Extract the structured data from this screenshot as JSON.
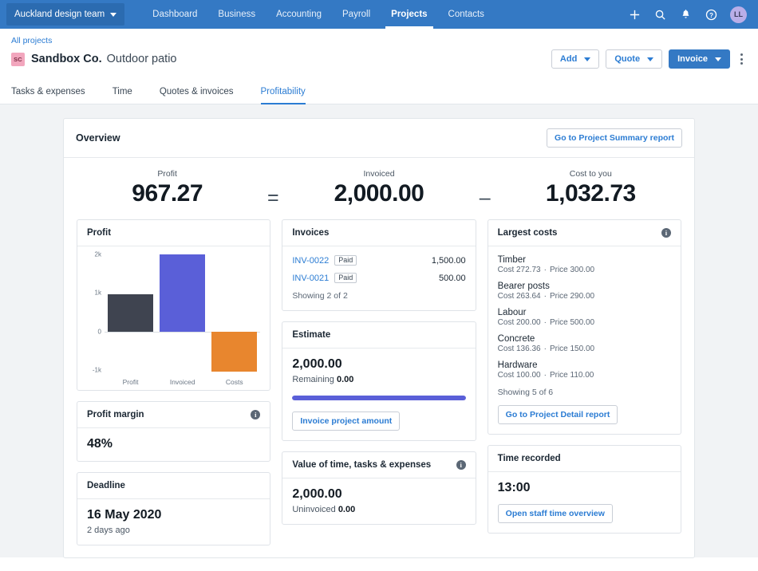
{
  "topnav": {
    "org": "Auckland design team",
    "items": [
      {
        "label": "Dashboard",
        "active": false
      },
      {
        "label": "Business",
        "active": false
      },
      {
        "label": "Accounting",
        "active": false
      },
      {
        "label": "Payroll",
        "active": false
      },
      {
        "label": "Projects",
        "active": true
      },
      {
        "label": "Contacts",
        "active": false
      }
    ],
    "icons": [
      "plus-icon",
      "search-icon",
      "bell-icon",
      "help-icon"
    ],
    "avatar_initials": "LL",
    "colors": {
      "bar": "#3479c4",
      "org_chip": "#2b6bb0",
      "avatar": "#b9aee8"
    }
  },
  "header": {
    "breadcrumb": "All projects",
    "client_initials": "SC",
    "client_name": "Sandbox Co.",
    "project_name": "Outdoor patio",
    "actions": {
      "add": "Add",
      "quote": "Quote",
      "invoice": "Invoice"
    }
  },
  "subtabs": [
    {
      "label": "Tasks & expenses",
      "active": false
    },
    {
      "label": "Time",
      "active": false
    },
    {
      "label": "Quotes & invoices",
      "active": false
    },
    {
      "label": "Profitability",
      "active": true
    }
  ],
  "overview": {
    "title": "Overview",
    "report_button": "Go to Project Summary report",
    "summary": {
      "profit_label": "Profit",
      "profit_value": "967.27",
      "equals": "=",
      "invoiced_label": "Invoiced",
      "invoiced_value": "2,000.00",
      "minus": "–",
      "cost_label": "Cost to you",
      "cost_value": "1,032.73"
    }
  },
  "chart_data": {
    "type": "bar",
    "title": "Profit",
    "categories": [
      "Profit",
      "Invoiced",
      "Costs"
    ],
    "values": [
      967.27,
      2000.0,
      -1032.73
    ],
    "colors": [
      "#3f4450",
      "#5a5fd8",
      "#e8862e"
    ],
    "ytick_labels": [
      "2k",
      "1k",
      "0",
      "-1k"
    ],
    "ytick_values": [
      2000,
      1000,
      0,
      -1000
    ],
    "ylim": [
      -1000,
      2000
    ],
    "xlabel": "",
    "ylabel": "",
    "grid": false,
    "legend": "none"
  },
  "profit_margin": {
    "title": "Profit margin",
    "value": "48%",
    "info_icon": "info-icon"
  },
  "deadline": {
    "title": "Deadline",
    "date": "16 May 2020",
    "relative": "2 days ago"
  },
  "invoices": {
    "title": "Invoices",
    "rows": [
      {
        "number": "INV-0022",
        "status": "Paid",
        "amount": "1,500.00"
      },
      {
        "number": "INV-0021",
        "status": "Paid",
        "amount": "500.00"
      }
    ],
    "showing": "Showing 2 of 2"
  },
  "estimate": {
    "title": "Estimate",
    "amount": "2,000.00",
    "remaining_label": "Remaining",
    "remaining_value": "0.00",
    "progress_percent": 100,
    "progress_color": "#5a5fd8",
    "button": "Invoice project amount"
  },
  "value_of_time": {
    "title": "Value of time, tasks & expenses",
    "info_icon": "info-icon",
    "amount": "2,000.00",
    "uninvoiced_label": "Uninvoiced",
    "uninvoiced_value": "0.00"
  },
  "largest_costs": {
    "title": "Largest costs",
    "info_icon": "info-icon",
    "items": [
      {
        "name": "Timber",
        "cost": "Cost 272.73",
        "price": "Price 300.00"
      },
      {
        "name": "Bearer posts",
        "cost": "Cost 263.64",
        "price": "Price 290.00"
      },
      {
        "name": "Labour",
        "cost": "Cost 200.00",
        "price": "Price 500.00"
      },
      {
        "name": "Concrete",
        "cost": "Cost 136.36",
        "price": "Price 150.00"
      },
      {
        "name": "Hardware",
        "cost": "Cost 100.00",
        "price": "Price 110.00"
      }
    ],
    "showing": "Showing 5 of 6",
    "button": "Go to Project Detail report"
  },
  "time_recorded": {
    "title": "Time recorded",
    "value": "13:00",
    "button": "Open staff time overview"
  }
}
